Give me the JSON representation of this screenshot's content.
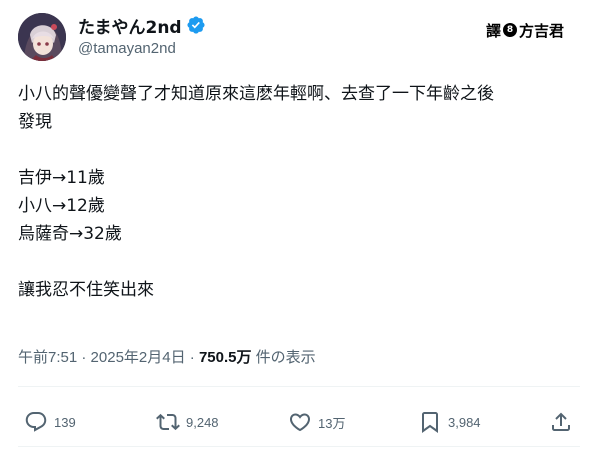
{
  "author": {
    "display_name": "たまやん2nd",
    "handle": "@tamayan2nd",
    "avatar_icon": "anime-character-avatar",
    "verified_icon": "verified-badge-icon",
    "verified_color": "#1d9bf0"
  },
  "stamp": {
    "part1": "譯",
    "badge": "8",
    "part2": "方吉君"
  },
  "tweet": {
    "lines": [
      "小八的聲優變聲了才知道原來這麽年輕啊、去查了一下年齡之後",
      "發現",
      "",
      "吉伊→11歲",
      "小八→12歲",
      "烏薩奇→32歲",
      "",
      "讓我忍不住笑出來"
    ]
  },
  "meta": {
    "time": "午前7:51",
    "separator": " · ",
    "date": "2025年2月4日",
    "views": "750.5万",
    "views_label": " 件の表示"
  },
  "actions": {
    "reply_count": "139",
    "retweet_count": "9,248",
    "like_count": "13万",
    "bookmark_count": "3,984"
  },
  "colors": {
    "text_primary": "#0f1419",
    "text_secondary": "#536471",
    "divider": "#eff3f4"
  }
}
